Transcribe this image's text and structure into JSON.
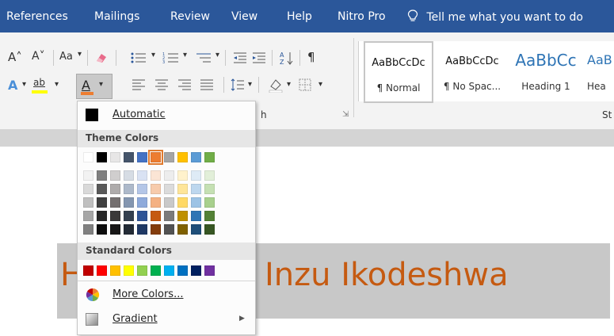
{
  "tabs": [
    "References",
    "Mailings",
    "Review",
    "View",
    "Help",
    "Nitro Pro"
  ],
  "tell_me": "Tell me what you want to do",
  "ribbon": {
    "grow_font": "A˄",
    "shrink_font": "A˅",
    "change_case": "Aa",
    "font_color_letter": "A",
    "text_effects_letter": "A",
    "highlight_letters": "ab",
    "pilcrow": "¶",
    "sort": "A↓",
    "group_label_partial": "h",
    "styles_group_partial": "St"
  },
  "styles": [
    {
      "sample": "AaBbCcDc",
      "name": "¶ Normal"
    },
    {
      "sample": "AaBbCcDc",
      "name": "¶ No Spac..."
    },
    {
      "sample": "AaBbCc",
      "name": "Heading 1"
    },
    {
      "sample": "AaB",
      "name": "Hea"
    }
  ],
  "menu": {
    "automatic": "Automatic",
    "theme_colors_header": "Theme Colors",
    "standard_colors_header": "Standard Colors",
    "more_colors": "More Colors...",
    "gradient": "Gradient"
  },
  "theme_colors": [
    [
      "#ffffff",
      "#f2f2f2",
      "#d9d9d9",
      "#bfbfbf",
      "#a6a6a6",
      "#808080"
    ],
    [
      "#000000",
      "#7f7f7f",
      "#595959",
      "#3f3f3f",
      "#262626",
      "#0c0c0c"
    ],
    [
      "#e7e6e6",
      "#d0cece",
      "#aeabab",
      "#757070",
      "#3a3838",
      "#171616"
    ],
    [
      "#44546a",
      "#d6dce4",
      "#adb9ca",
      "#8496b0",
      "#333f4f",
      "#222a35"
    ],
    [
      "#4472c4",
      "#d9e2f3",
      "#b4c6e7",
      "#8eaadb",
      "#2f5496",
      "#1f3864"
    ],
    [
      "#ed7d31",
      "#fbe5d5",
      "#f7cbac",
      "#f4b183",
      "#c55a11",
      "#833c0b"
    ],
    [
      "#a5a5a5",
      "#ededed",
      "#dbdbdb",
      "#c9c9c9",
      "#7b7b7b",
      "#525252"
    ],
    [
      "#ffc000",
      "#fff2cc",
      "#fee599",
      "#ffd965",
      "#bf9000",
      "#7f6000"
    ],
    [
      "#5b9bd5",
      "#deebf6",
      "#bdd7ee",
      "#9cc3e5",
      "#2e75b5",
      "#1e4e79"
    ],
    [
      "#70ad47",
      "#e2efd9",
      "#c5e0b3",
      "#a8d08d",
      "#538135",
      "#375623"
    ]
  ],
  "standard_colors": [
    "#c00000",
    "#ff0000",
    "#ffc000",
    "#ffff00",
    "#92d050",
    "#00b050",
    "#00b0f0",
    "#0070c0",
    "#002060",
    "#7030a0"
  ],
  "document": {
    "first_letter": "H",
    "text": "Inzu Ikodeshwa",
    "text_color": "#c55a11"
  },
  "colors": {
    "ribbon_blue": "#2b579a",
    "menu_header_bg": "#e6e6e6"
  }
}
